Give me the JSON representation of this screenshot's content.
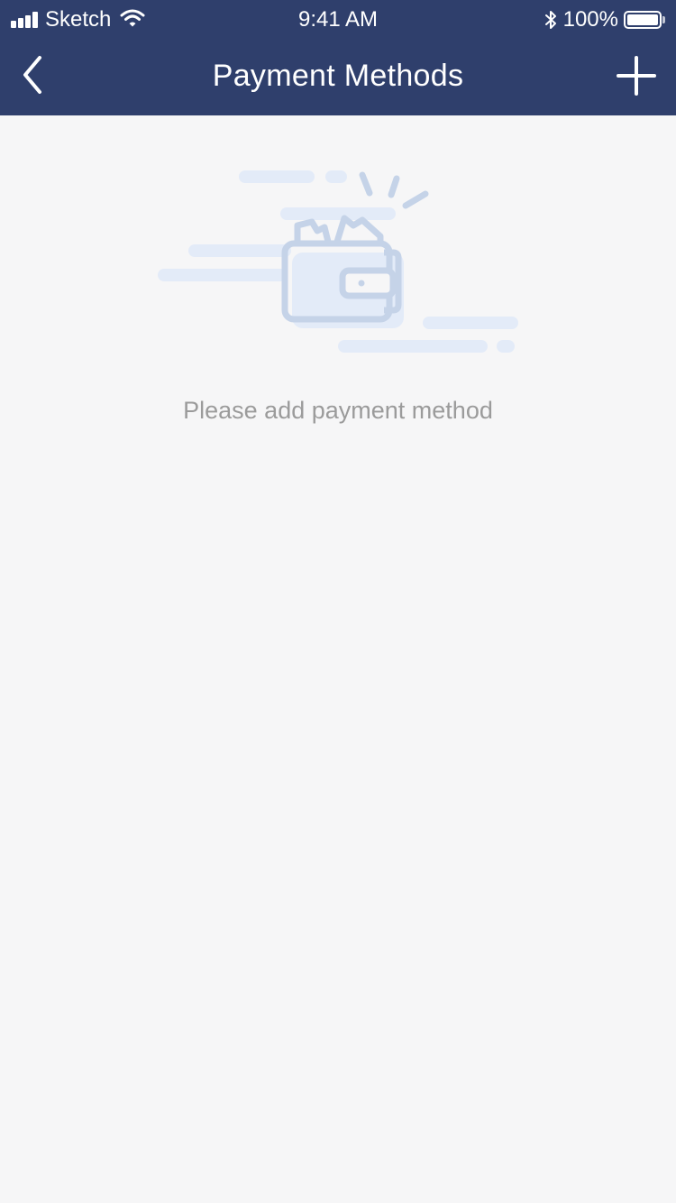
{
  "status_bar": {
    "carrier": "Sketch",
    "time": "9:41 AM",
    "battery": "100%"
  },
  "nav": {
    "title": "Payment Methods"
  },
  "empty_state": {
    "message": "Please add payment method"
  },
  "colors": {
    "nav_background": "#2f3f6c",
    "page_background": "#f6f6f7",
    "illustration_primary": "#c5d3e8",
    "illustration_light": "#e3ebf8",
    "empty_text": "#9b9b9b"
  },
  "icons": [
    "signal-icon",
    "wifi-icon",
    "bluetooth-icon",
    "battery-icon",
    "back-arrow-icon",
    "plus-icon",
    "empty-wallet-illustration"
  ]
}
